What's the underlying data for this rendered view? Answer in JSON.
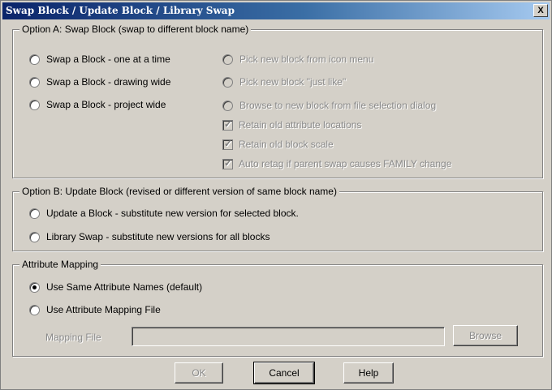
{
  "window": {
    "title": "Swap Block / Update Block / Library Swap",
    "close_label": "X"
  },
  "option_a": {
    "legend": "Option A: Swap Block (swap to different block name)",
    "radios": [
      {
        "label": "Swap a Block - one at a time",
        "checked": false
      },
      {
        "label": "Swap a Block - drawing wide",
        "checked": false
      },
      {
        "label": "Swap a Block - project wide",
        "checked": false
      }
    ],
    "sub_radios": [
      {
        "label": "Pick new block from icon menu",
        "enabled": false
      },
      {
        "label": "Pick new block \"just like\"",
        "enabled": false
      },
      {
        "label": "Browse to new block from file selection dialog",
        "enabled": false
      }
    ],
    "checks": [
      {
        "label": "Retain old attribute locations",
        "checked": true,
        "enabled": false
      },
      {
        "label": "Retain old block scale",
        "checked": true,
        "enabled": false
      },
      {
        "label": "Auto retag if parent swap causes FAMILY change",
        "checked": true,
        "enabled": false
      }
    ]
  },
  "option_b": {
    "legend": "Option B: Update Block (revised or different version of same block name)",
    "radios": [
      {
        "label": "Update a Block - substitute new version for selected block.",
        "checked": false
      },
      {
        "label": "Library Swap - substitute new versions for all blocks",
        "checked": false
      }
    ]
  },
  "attribute_mapping": {
    "legend": "Attribute Mapping",
    "radios": [
      {
        "label": "Use Same Attribute Names (default)",
        "checked": true
      },
      {
        "label": "Use Attribute Mapping File",
        "checked": false
      }
    ],
    "mapping_file_label": "Mapping File",
    "mapping_file_value": "",
    "browse_label": "Browse"
  },
  "buttons": {
    "ok": "OK",
    "cancel": "Cancel",
    "help": "Help"
  },
  "colors": {
    "face": "#d4d0c8",
    "title_start": "#0a246a",
    "title_end": "#a6caf0"
  }
}
